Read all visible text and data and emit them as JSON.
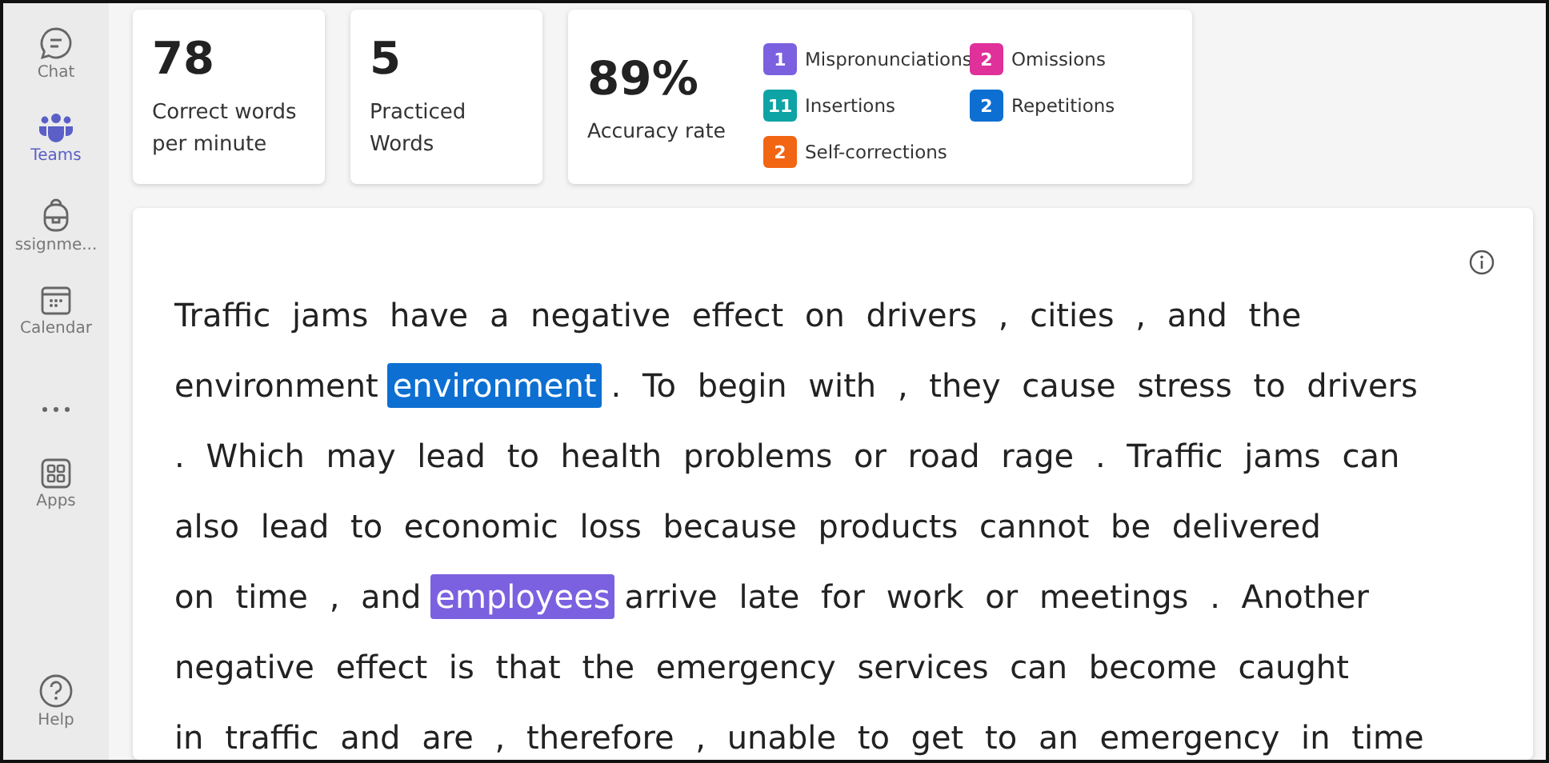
{
  "sidebar": {
    "items": [
      {
        "label": "Chat",
        "kind": "chat",
        "selected": false
      },
      {
        "label": "Teams",
        "kind": "teams",
        "selected": true
      },
      {
        "label": "ssignme...",
        "kind": "backpack",
        "selected": false
      },
      {
        "label": "Calendar",
        "kind": "calendar",
        "selected": false
      },
      {
        "kind": "more",
        "selected": false
      },
      {
        "label": "Apps",
        "kind": "apps",
        "selected": false
      }
    ],
    "help": {
      "label": "Help"
    }
  },
  "stats": [
    {
      "value": "78",
      "label": "Correct words per minute"
    },
    {
      "value": "5",
      "label": "Practiced Words"
    }
  ],
  "accuracy": {
    "value": "89%",
    "label": "Accuracy rate",
    "errors": [
      {
        "count": "1",
        "label": "Mispronunciations",
        "color": "#7b61e0"
      },
      {
        "count": "2",
        "label": "Omissions",
        "color": "#e0309a"
      },
      {
        "count": "11",
        "label": "Insertions",
        "color": "#0ea3a5"
      },
      {
        "count": "2",
        "label": "Repetitions",
        "color": "#0d6fd1"
      },
      {
        "count": "2",
        "label": "Self-corrections",
        "color": "#f26513"
      }
    ]
  },
  "passage": {
    "lines": [
      [
        {
          "kind": "text",
          "text": "Traffic jams have a negative effect on drivers , cities , and the"
        }
      ],
      [
        {
          "kind": "text",
          "text": "environment"
        },
        {
          "kind": "mark",
          "text": "environment",
          "color": "#0d6fd1"
        },
        {
          "kind": "text",
          "text": ". To begin with , they cause stress to drivers"
        }
      ],
      [
        {
          "kind": "text",
          "text": ". Which may lead to health problems or road rage . Traffic jams can"
        }
      ],
      [
        {
          "kind": "text",
          "text": "also lead to economic loss because products cannot be delivered"
        }
      ],
      [
        {
          "kind": "text",
          "text": "on time , and"
        },
        {
          "kind": "mark",
          "text": "employees",
          "color": "#7b61e0"
        },
        {
          "kind": "text",
          "text": "arrive late for work or meetings . Another"
        }
      ],
      [
        {
          "kind": "text",
          "text": "negative effect is that the emergency services can become caught"
        }
      ],
      [
        {
          "kind": "text",
          "text": "in traffic and are , therefore , unable to get to an emergency in time"
        }
      ]
    ]
  }
}
